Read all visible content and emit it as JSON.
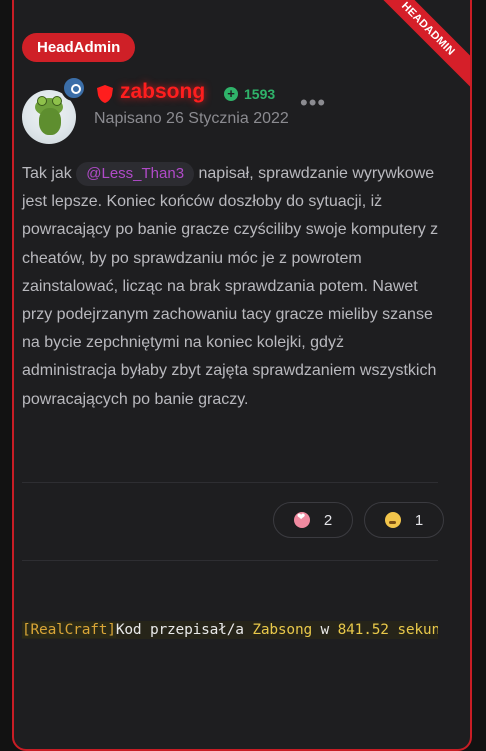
{
  "post": {
    "role_ribbon": "HEADADMIN",
    "group_badge": "HeadAdmin",
    "author": {
      "username": "zabsong",
      "reputation": "1593"
    },
    "posted_date": "Napisano 26 Stycznia 2022",
    "body": {
      "prefix": "Tak jak ",
      "mention": "@Less_Than3",
      "text": " napisał, sprawdzanie wyrywkowe jest lepsze. Koniec końców doszłoby do sytuacji, iż powracający po banie gracze czyściliby swoje komputery z cheatów, by po sprawdzaniu móc je z powrotem zainstalować, licząc na brak sprawdzania potem.  Nawet przy podejrzanym zachowaniu tacy gracze mieliby szanse na bycie zepchniętymi na koniec kolejki, gdyż administracja byłaby zbyt zajęta sprawdzaniem wszystkich powracających po banie graczy."
    },
    "reactions": [
      {
        "icon": "heart-reaction-icon",
        "count": "2"
      },
      {
        "icon": "thinking-face-icon",
        "count": "1"
      }
    ],
    "signature": {
      "tag": "[RealCraft]",
      "text1": "Kod przepisał/a ",
      "name": "Zabsong",
      "text2": " w ",
      "time": "841.52",
      "unit": " sekund"
    }
  },
  "colors": {
    "accent_red": "#cf2027",
    "username_red": "#ff1e1e",
    "reputation_green": "#2fb36a",
    "mention_purple": "#b04ac8"
  }
}
